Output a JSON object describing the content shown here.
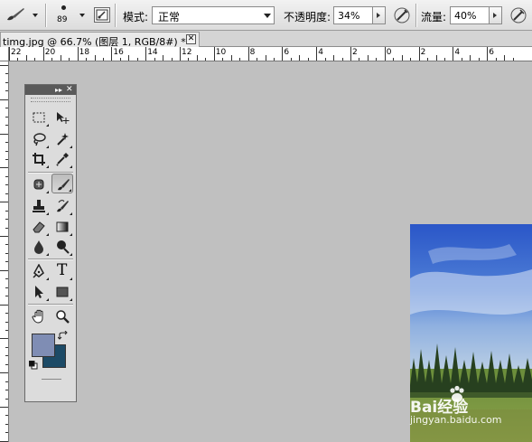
{
  "options_bar": {
    "tool_preset_icon": "brush-icon",
    "brush_size": "89",
    "panel_toggle_icon": "brush-panel-icon",
    "mode_label": "模式:",
    "mode_value": "正常",
    "opacity_label": "不透明度:",
    "opacity_value": "34%",
    "flow_label": "流量:",
    "flow_value": "40%",
    "airbrush_icon": "airbrush-icon",
    "tablet_icon": "tablet-pressure-icon"
  },
  "document_tab": {
    "title": "timg.jpg @ 66.7% (图层 1, RGB/8#) *",
    "close": "✕"
  },
  "ruler_h": {
    "labels": [
      "22",
      "20",
      "18",
      "16",
      "14",
      "12",
      "10",
      "8",
      "6",
      "4",
      "2",
      "0",
      "2",
      "4",
      "6"
    ]
  },
  "toolbox": {
    "collapse": "▸▸",
    "close": "✕",
    "tools": [
      {
        "name": "marquee-tool",
        "icon": "marquee-icon"
      },
      {
        "name": "move-tool",
        "icon": "move-icon"
      },
      {
        "name": "lasso-tool",
        "icon": "lasso-icon"
      },
      {
        "name": "magic-wand-tool",
        "icon": "magic-wand-icon"
      },
      {
        "name": "crop-tool",
        "icon": "crop-icon"
      },
      {
        "name": "eyedropper-tool",
        "icon": "eyedropper-icon"
      },
      {
        "name": "healing-tool",
        "icon": "healing-icon"
      },
      {
        "name": "brush-tool",
        "icon": "brush-icon",
        "active": true
      },
      {
        "name": "clone-stamp-tool",
        "icon": "stamp-icon"
      },
      {
        "name": "history-brush-tool",
        "icon": "history-brush-icon"
      },
      {
        "name": "eraser-tool",
        "icon": "eraser-icon"
      },
      {
        "name": "gradient-tool",
        "icon": "gradient-icon"
      },
      {
        "name": "blur-tool",
        "icon": "blur-icon"
      },
      {
        "name": "dodge-tool",
        "icon": "dodge-icon"
      },
      {
        "name": "pen-tool",
        "icon": "pen-icon"
      },
      {
        "name": "type-tool",
        "icon": "type-icon"
      },
      {
        "name": "path-select-tool",
        "icon": "path-select-icon"
      },
      {
        "name": "shape-tool",
        "icon": "rectangle-icon"
      },
      {
        "name": "hand-tool",
        "icon": "hand-icon"
      },
      {
        "name": "zoom-tool",
        "icon": "zoom-icon"
      }
    ],
    "type_glyph": "T",
    "foreground_color": "#7f8db4",
    "background_color": "#1c4a66"
  },
  "watermark": {
    "brand": "Bai经验",
    "url": "jingyan.baidu.com"
  }
}
